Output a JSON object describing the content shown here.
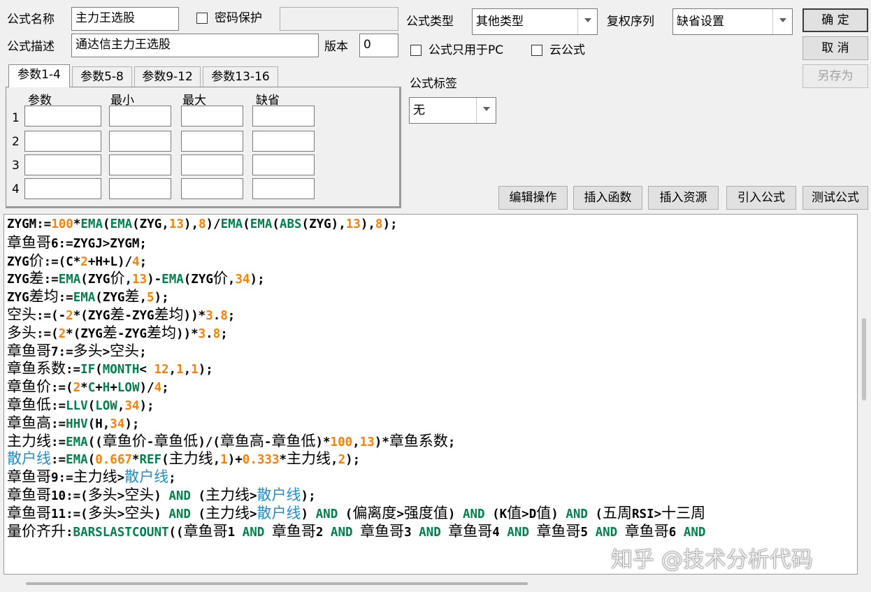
{
  "header": {
    "name_label": "公式名称",
    "name_value": "主力王选股",
    "password_label": "密码保护",
    "desc_label": "公式描述",
    "desc_value": "通达信主力王选股",
    "version_label": "版本",
    "version_value": "0",
    "type_label": "公式类型",
    "type_value": "其他类型",
    "restore_label": "复权序列",
    "restore_value": "缺省设置",
    "pc_only_label": "公式只用于PC",
    "cloud_label": "云公式",
    "tag_label": "公式标签",
    "tag_value": "无"
  },
  "buttons": {
    "ok": "确 定",
    "cancel": "取 消",
    "save_as": "另存为",
    "edit_ops": "编辑操作",
    "insert_func": "插入函数",
    "insert_res": "插入资源",
    "import_formula": "引入公式",
    "test_formula": "测试公式"
  },
  "tabs": [
    "参数1-4",
    "参数5-8",
    "参数9-12",
    "参数13-16"
  ],
  "params": {
    "headers": [
      "参数",
      "最小",
      "最大",
      "缺省"
    ],
    "rows": [
      "1",
      "2",
      "3",
      "4"
    ]
  },
  "code_lines": [
    [
      [
        "idb",
        "ZYGM:="
      ],
      [
        "num",
        "100"
      ],
      [
        "op",
        "*"
      ],
      [
        "fn",
        "EMA"
      ],
      [
        "op",
        "("
      ],
      [
        "fn",
        "EMA"
      ],
      [
        "op",
        "(ZYG,"
      ],
      [
        "num",
        "13"
      ],
      [
        "op",
        "),"
      ],
      [
        "num",
        "8"
      ],
      [
        "op",
        ")/"
      ],
      [
        "fn",
        "EMA"
      ],
      [
        "op",
        "("
      ],
      [
        "fn",
        "EMA"
      ],
      [
        "op",
        "("
      ],
      [
        "fn",
        "ABS"
      ],
      [
        "op",
        "(ZYG),"
      ],
      [
        "num",
        "13"
      ],
      [
        "op",
        "),"
      ],
      [
        "num",
        "8"
      ],
      [
        "op",
        ");"
      ]
    ],
    [
      [
        "id",
        "章鱼哥"
      ],
      [
        "idb",
        "6:=ZYGJ>ZYGM;"
      ]
    ],
    [
      [
        "idb",
        "ZYG"
      ],
      [
        "id",
        "价"
      ],
      [
        "op",
        ":=(C*"
      ],
      [
        "num",
        "2"
      ],
      [
        "op",
        "+H+L)/"
      ],
      [
        "num",
        "4"
      ],
      [
        "op",
        ";"
      ]
    ],
    [
      [
        "idb",
        "ZYG"
      ],
      [
        "id",
        "差"
      ],
      [
        "op",
        ":="
      ],
      [
        "fn",
        "EMA"
      ],
      [
        "op",
        "(ZYG"
      ],
      [
        "id",
        "价"
      ],
      [
        "op",
        ","
      ],
      [
        "num",
        "13"
      ],
      [
        "op",
        ")-"
      ],
      [
        "fn",
        "EMA"
      ],
      [
        "op",
        "(ZYG"
      ],
      [
        "id",
        "价"
      ],
      [
        "op",
        ","
      ],
      [
        "num",
        "34"
      ],
      [
        "op",
        ");"
      ]
    ],
    [
      [
        "idb",
        "ZYG"
      ],
      [
        "id",
        "差均"
      ],
      [
        "op",
        ":="
      ],
      [
        "fn",
        "EMA"
      ],
      [
        "op",
        "(ZYG"
      ],
      [
        "id",
        "差"
      ],
      [
        "op",
        ","
      ],
      [
        "num",
        "5"
      ],
      [
        "op",
        ");"
      ]
    ],
    [
      [
        "id",
        "空头"
      ],
      [
        "op",
        ":=(-"
      ],
      [
        "num",
        "2"
      ],
      [
        "op",
        "*(ZYG"
      ],
      [
        "id",
        "差"
      ],
      [
        "op",
        "-ZYG"
      ],
      [
        "id",
        "差均"
      ],
      [
        "op",
        "))*"
      ],
      [
        "num",
        "3"
      ],
      [
        "op",
        "."
      ],
      [
        "num",
        "8"
      ],
      [
        "op",
        ";"
      ]
    ],
    [
      [
        "id",
        "多头"
      ],
      [
        "op",
        ":=("
      ],
      [
        "num",
        "2"
      ],
      [
        "op",
        "*(ZYG"
      ],
      [
        "id",
        "差"
      ],
      [
        "op",
        "-ZYG"
      ],
      [
        "id",
        "差均"
      ],
      [
        "op",
        "))*"
      ],
      [
        "num",
        "3"
      ],
      [
        "op",
        "."
      ],
      [
        "num",
        "8"
      ],
      [
        "op",
        ";"
      ]
    ],
    [
      [
        "id",
        "章鱼哥"
      ],
      [
        "idb",
        "7:="
      ],
      [
        "id",
        "多头"
      ],
      [
        "op",
        ">"
      ],
      [
        "id",
        "空头"
      ],
      [
        "op",
        ";"
      ]
    ],
    [
      [
        "id",
        "章鱼系数"
      ],
      [
        "op",
        ":="
      ],
      [
        "fn",
        "IF"
      ],
      [
        "op",
        "("
      ],
      [
        "fn",
        "MONTH"
      ],
      [
        "op",
        "< "
      ],
      [
        "num",
        "12"
      ],
      [
        "op",
        ","
      ],
      [
        "num",
        "1"
      ],
      [
        "op",
        ","
      ],
      [
        "num",
        "1"
      ],
      [
        "op",
        ");"
      ]
    ],
    [
      [
        "id",
        "章鱼价"
      ],
      [
        "op",
        ":=("
      ],
      [
        "num",
        "2"
      ],
      [
        "op",
        "*"
      ],
      [
        "fn",
        "C"
      ],
      [
        "op",
        "+"
      ],
      [
        "fn",
        "H"
      ],
      [
        "op",
        "+"
      ],
      [
        "fn",
        "LOW"
      ],
      [
        "op",
        ")/"
      ],
      [
        "num",
        "4"
      ],
      [
        "op",
        ";"
      ]
    ],
    [
      [
        "id",
        "章鱼低"
      ],
      [
        "op",
        ":="
      ],
      [
        "fn",
        "LLV"
      ],
      [
        "op",
        "("
      ],
      [
        "fn",
        "LOW"
      ],
      [
        "op",
        ","
      ],
      [
        "num",
        "34"
      ],
      [
        "op",
        ");"
      ]
    ],
    [
      [
        "id",
        "章鱼高"
      ],
      [
        "op",
        ":="
      ],
      [
        "fn",
        "HHV"
      ],
      [
        "op",
        "(H,"
      ],
      [
        "num",
        "34"
      ],
      [
        "op",
        ");"
      ]
    ],
    [
      [
        "id",
        "主力线"
      ],
      [
        "op",
        ":="
      ],
      [
        "fn",
        "EMA"
      ],
      [
        "op",
        "(("
      ],
      [
        "id",
        "章鱼价"
      ],
      [
        "op",
        "-"
      ],
      [
        "id",
        "章鱼低"
      ],
      [
        "op",
        ")/("
      ],
      [
        "id",
        "章鱼高"
      ],
      [
        "op",
        "-"
      ],
      [
        "id",
        "章鱼低"
      ],
      [
        "op",
        ")*"
      ],
      [
        "num",
        "100"
      ],
      [
        "op",
        ","
      ],
      [
        "num",
        "13"
      ],
      [
        "op",
        ")*"
      ],
      [
        "id",
        "章鱼系数"
      ],
      [
        "op",
        ";"
      ]
    ],
    [
      [
        "blue",
        "散户线"
      ],
      [
        "op",
        ":="
      ],
      [
        "fn",
        "EMA"
      ],
      [
        "op",
        "("
      ],
      [
        "num",
        "0.667"
      ],
      [
        "op",
        "*"
      ],
      [
        "fn",
        "REF"
      ],
      [
        "op",
        "("
      ],
      [
        "id",
        "主力线"
      ],
      [
        "op",
        ","
      ],
      [
        "num",
        "1"
      ],
      [
        "op",
        ")+"
      ],
      [
        "num",
        "0.333"
      ],
      [
        "op",
        "*"
      ],
      [
        "id",
        "主力线"
      ],
      [
        "op",
        ","
      ],
      [
        "num",
        "2"
      ],
      [
        "op",
        ");"
      ]
    ],
    [
      [
        "id",
        "章鱼哥"
      ],
      [
        "idb",
        "9:="
      ],
      [
        "id",
        "主力线"
      ],
      [
        "op",
        ">"
      ],
      [
        "blue",
        "散户线"
      ],
      [
        "op",
        ";"
      ]
    ],
    [
      [
        "id",
        "章鱼哥"
      ],
      [
        "idb",
        "10:=("
      ],
      [
        "id",
        "多头"
      ],
      [
        "op",
        ">"
      ],
      [
        "id",
        "空头"
      ],
      [
        "op",
        ") "
      ],
      [
        "kw",
        "AND"
      ],
      [
        "op",
        " ("
      ],
      [
        "id",
        "主力线"
      ],
      [
        "op",
        ">"
      ],
      [
        "blue",
        "散户线"
      ],
      [
        "op",
        ");"
      ]
    ],
    [
      [
        "id",
        "章鱼哥"
      ],
      [
        "idb",
        "11:=("
      ],
      [
        "id",
        "多头"
      ],
      [
        "op",
        ">"
      ],
      [
        "id",
        "空头"
      ],
      [
        "op",
        ") "
      ],
      [
        "kw",
        "AND"
      ],
      [
        "op",
        " ("
      ],
      [
        "id",
        "主力线"
      ],
      [
        "op",
        ">"
      ],
      [
        "blue",
        "散户线"
      ],
      [
        "op",
        ") "
      ],
      [
        "kw",
        "AND"
      ],
      [
        "op",
        " ("
      ],
      [
        "id",
        "偏离度"
      ],
      [
        "op",
        ">"
      ],
      [
        "id",
        "强度值"
      ],
      [
        "op",
        ") "
      ],
      [
        "kw",
        "AND"
      ],
      [
        "op",
        " (K"
      ],
      [
        "id",
        "值"
      ],
      [
        "op",
        ">D"
      ],
      [
        "id",
        "值"
      ],
      [
        "op",
        ") "
      ],
      [
        "kw",
        "AND"
      ],
      [
        "op",
        " ("
      ],
      [
        "id",
        "五周"
      ],
      [
        "op",
        "RSI>"
      ],
      [
        "id",
        "十三周"
      ]
    ],
    [
      [
        "id",
        "量价齐升"
      ],
      [
        "op",
        ":"
      ],
      [
        "fn",
        "BARSLASTCOUNT"
      ],
      [
        "op",
        "(("
      ],
      [
        "id",
        "章鱼哥"
      ],
      [
        "op",
        "1 "
      ],
      [
        "kw",
        "AND"
      ],
      [
        "op",
        " "
      ],
      [
        "id",
        "章鱼哥"
      ],
      [
        "op",
        "2 "
      ],
      [
        "kw",
        "AND"
      ],
      [
        "op",
        " "
      ],
      [
        "id",
        "章鱼哥"
      ],
      [
        "op",
        "3 "
      ],
      [
        "kw",
        "AND"
      ],
      [
        "op",
        " "
      ],
      [
        "id",
        "章鱼哥"
      ],
      [
        "op",
        "4 "
      ],
      [
        "kw",
        "AND"
      ],
      [
        "op",
        " "
      ],
      [
        "id",
        "章鱼哥"
      ],
      [
        "op",
        "5 "
      ],
      [
        "kw",
        "AND"
      ],
      [
        "op",
        " "
      ],
      [
        "id",
        "章鱼哥"
      ],
      [
        "op",
        "6 "
      ],
      [
        "kw",
        "AND"
      ]
    ]
  ],
  "watermark": "知乎 @技术分析代码"
}
